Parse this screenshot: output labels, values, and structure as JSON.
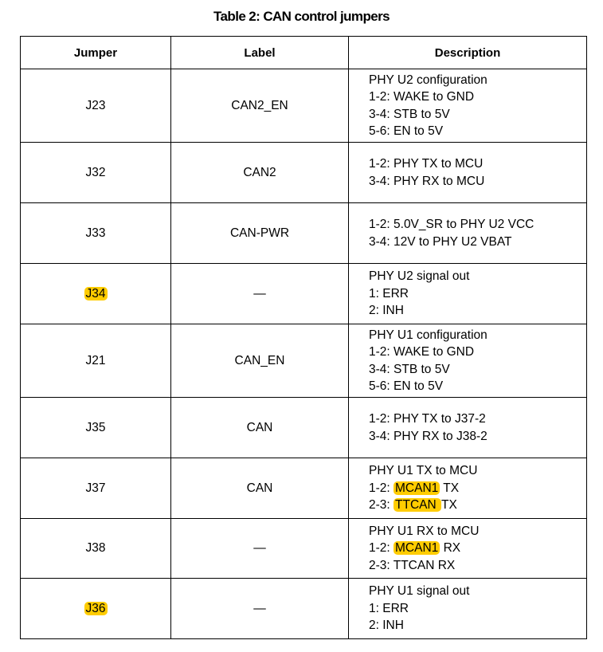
{
  "caption": "Table 2: CAN control jumpers",
  "highlight_color": "#ffcc00",
  "headers": {
    "jumper": "Jumper",
    "label": "Label",
    "description": "Description"
  },
  "rows": [
    {
      "jumper": "J23",
      "jumper_highlighted": false,
      "label": "CAN2_EN",
      "description": [
        [
          {
            "t": "PHY U2 configuration"
          }
        ],
        [
          {
            "t": "1-2: WAKE to GND"
          }
        ],
        [
          {
            "t": "3-4: STB to 5V"
          }
        ],
        [
          {
            "t": "5-6: EN to 5V"
          }
        ]
      ],
      "height": 92
    },
    {
      "jumper": "J32",
      "jumper_highlighted": false,
      "label": "CAN2",
      "description": [
        [
          {
            "t": "1-2: PHY TX to MCU"
          }
        ],
        [
          {
            "t": "3-4: PHY RX to MCU"
          }
        ]
      ],
      "height": 76
    },
    {
      "jumper": "J33",
      "jumper_highlighted": false,
      "label": "CAN-PWR",
      "description": [
        [
          {
            "t": "1-2: 5.0V_SR to PHY U2 VCC"
          }
        ],
        [
          {
            "t": "3-4: 12V to PHY U2 VBAT"
          }
        ]
      ],
      "height": 76
    },
    {
      "jumper": "J34",
      "jumper_highlighted": true,
      "label": "—",
      "description": [
        [
          {
            "t": "PHY U2 signal out"
          }
        ],
        [
          {
            "t": "1: ERR"
          }
        ],
        [
          {
            "t": "2: INH"
          }
        ]
      ],
      "height": 76
    },
    {
      "jumper": "J21",
      "jumper_highlighted": false,
      "label": "CAN_EN",
      "description": [
        [
          {
            "t": "PHY U1 configuration"
          }
        ],
        [
          {
            "t": "1-2: WAKE to GND"
          }
        ],
        [
          {
            "t": "3-4: STB to 5V"
          }
        ],
        [
          {
            "t": "5-6: EN to 5V"
          }
        ]
      ],
      "height": 92
    },
    {
      "jumper": "J35",
      "jumper_highlighted": false,
      "label": "CAN",
      "description": [
        [
          {
            "t": "1-2: PHY TX to J37-2"
          }
        ],
        [
          {
            "t": "3-4: PHY RX to J38-2"
          }
        ]
      ],
      "height": 76
    },
    {
      "jumper": "J37",
      "jumper_highlighted": false,
      "label": "CAN",
      "description": [
        [
          {
            "t": "PHY U1 TX to MCU"
          }
        ],
        [
          {
            "t": "1-2: "
          },
          {
            "t": "MCAN1",
            "hl": true
          },
          {
            "t": " TX"
          }
        ],
        [
          {
            "t": "2-3: "
          },
          {
            "t": "TTCAN ",
            "hl": true
          },
          {
            "t": "TX"
          }
        ]
      ],
      "height": 76
    },
    {
      "jumper": "J38",
      "jumper_highlighted": false,
      "label": "—",
      "description": [
        [
          {
            "t": "PHY U1 RX to MCU"
          }
        ],
        [
          {
            "t": "1-2: "
          },
          {
            "t": "MCAN1",
            "hl": true
          },
          {
            "t": " RX"
          }
        ],
        [
          {
            "t": "2-3: TTCAN RX"
          }
        ]
      ],
      "height": 75
    },
    {
      "jumper": "J36",
      "jumper_highlighted": true,
      "label": "—",
      "description": [
        [
          {
            "t": "PHY U1 signal out"
          }
        ],
        [
          {
            "t": "1: ERR"
          }
        ],
        [
          {
            "t": "2: INH"
          }
        ]
      ],
      "height": 76
    }
  ]
}
